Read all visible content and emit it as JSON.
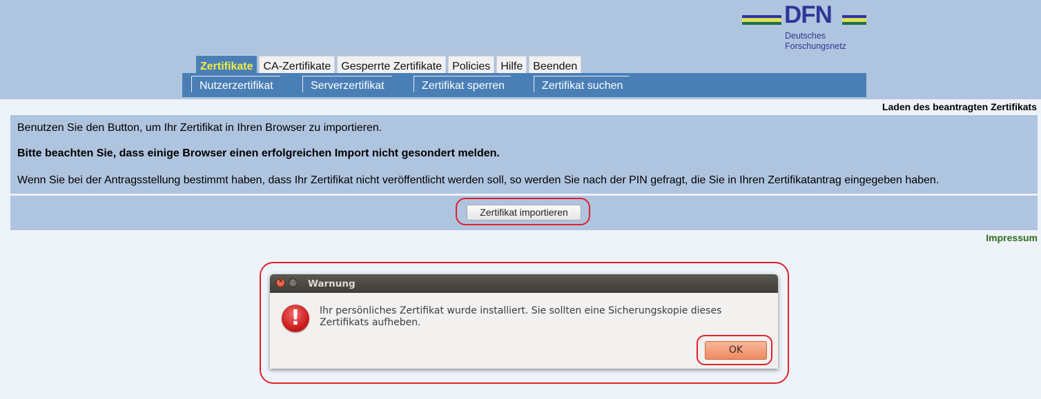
{
  "logo": {
    "word": "DFN",
    "subtitle_line1": "Deutsches",
    "subtitle_line2": "Forschungsnetz",
    "colors": {
      "blue": "#2e3796",
      "yellow": "#e8e325",
      "green": "#1f6f3c"
    }
  },
  "tabs": [
    {
      "label": "Zertifikate",
      "active": true
    },
    {
      "label": "CA-Zertifikate",
      "active": false
    },
    {
      "label": "Gesperrte Zertifikate",
      "active": false
    },
    {
      "label": "Policies",
      "active": false
    },
    {
      "label": "Hilfe",
      "active": false
    },
    {
      "label": "Beenden",
      "active": false
    }
  ],
  "subnav": [
    {
      "label": "Nutzerzertifikat"
    },
    {
      "label": "Serverzertifikat"
    },
    {
      "label": "Zertifikat sperren"
    },
    {
      "label": "Zertifikat suchen"
    }
  ],
  "page_title": "Laden des beantragten Zertifikats",
  "info": {
    "line1": "Benutzen Sie den Button, um Ihr Zertifikat in Ihren Browser zu importieren.",
    "line2": "Bitte beachten Sie, dass einige Browser einen erfolgreichen Import nicht gesondert melden.",
    "line3": "Wenn Sie bei der Antragsstellung bestimmt haben, dass Ihr Zertifikat nicht veröffentlicht werden soll, so werden Sie nach der PIN gefragt, die Sie in Ihren Zertifikatantrag eingegeben haben."
  },
  "import_button": "Zertifikat importieren",
  "impressum": "Impressum",
  "dialog": {
    "title": "Warnung",
    "icon": "warning-exclamation-icon",
    "icon_glyph": "!",
    "message": "Ihr persönliches Zertifikat wurde installiert. Sie sollten eine Sicherungskopie dieses Zertifikats aufheben.",
    "ok_label": "OK"
  },
  "highlight_color": "#e0202a"
}
